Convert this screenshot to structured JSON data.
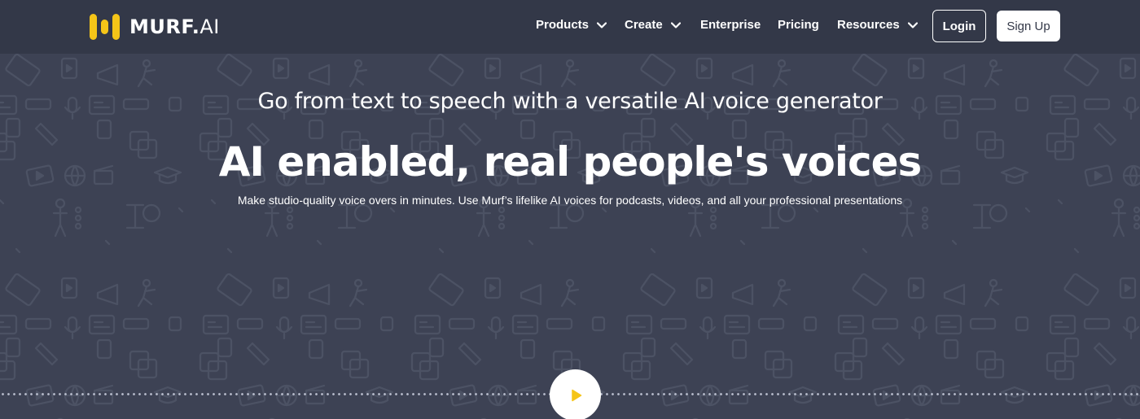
{
  "brand": {
    "name_bold": "MURF",
    "name_dot": ".",
    "name_thin": "AI",
    "accent_color": "#f5c518",
    "logo_icon": "murf-bars-icon"
  },
  "nav": {
    "items": [
      {
        "label": "Products",
        "has_dropdown": true
      },
      {
        "label": "Create",
        "has_dropdown": true
      },
      {
        "label": "Enterprise",
        "has_dropdown": false
      },
      {
        "label": "Pricing",
        "has_dropdown": false
      },
      {
        "label": "Resources",
        "has_dropdown": true
      }
    ],
    "login_label": "Login",
    "signup_label": "Sign Up"
  },
  "hero": {
    "subtitle": "Go from text to speech with a versatile AI voice generator",
    "title": "AI enabled, real people's voices",
    "description": "Make studio-quality voice overs in minutes. Use Murf’s lifelike AI voices for podcasts, videos, and all your professional presentations",
    "play_icon": "play-icon",
    "background_color": "#3d4254",
    "header_color": "#333848"
  }
}
